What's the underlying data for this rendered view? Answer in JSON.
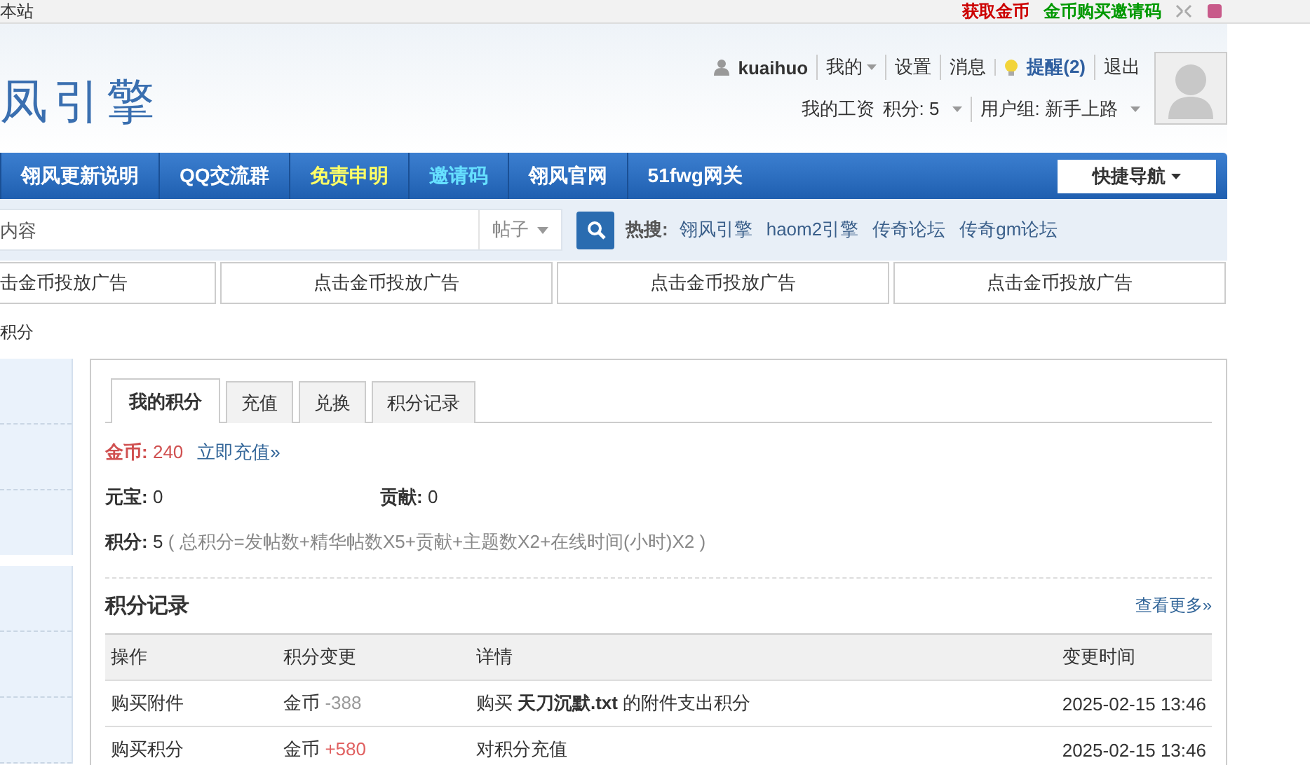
{
  "topbar": {
    "left": "本站",
    "links": [
      {
        "label": "获取金币",
        "color": "#cc0000"
      },
      {
        "label": "金币购买邀请码",
        "color": "#009900"
      }
    ]
  },
  "logo": "凤引擎",
  "user": {
    "name": "kuaihuo",
    "menu": [
      {
        "label": "我的",
        "dropdown": true
      },
      {
        "label": "设置",
        "dropdown": false
      },
      {
        "label": "消息",
        "dropdown": false
      }
    ],
    "notice": "提醒(2)",
    "logout": "退出",
    "salary": "我的工资",
    "credits": "积分: 5",
    "group": "用户组: 新手上路"
  },
  "nav": {
    "items": [
      {
        "label": "翎风更新说明",
        "kind": "plain"
      },
      {
        "label": "QQ交流群",
        "kind": "plain"
      },
      {
        "label": "免责申明",
        "kind": "notice"
      },
      {
        "label": "邀请码",
        "kind": "invite"
      },
      {
        "label": "翎风官网",
        "kind": "plain"
      },
      {
        "label": "51fwg网关",
        "kind": "plain"
      }
    ],
    "quick": "快捷导航"
  },
  "search": {
    "placeholder": "内容",
    "type": "帖子",
    "hot_label": "热搜:",
    "hot": [
      "翎风引擎",
      "haom2引擎",
      "传奇论坛",
      "传奇gm论坛"
    ]
  },
  "ads": [
    "击金币投放广告",
    "点击金币投放广告",
    "点击金币投放广告",
    "点击金币投放广告"
  ],
  "breadcrumb": "积分",
  "tabs": [
    {
      "label": "我的积分",
      "selected": true
    },
    {
      "label": "充值",
      "selected": false
    },
    {
      "label": "兑换",
      "selected": false
    },
    {
      "label": "积分记录",
      "selected": false
    }
  ],
  "gold": {
    "label": "金币:",
    "value": "240",
    "link": "立即充值»"
  },
  "stats": [
    {
      "label": "元宝:",
      "value": "0"
    },
    {
      "label": "贡献:",
      "value": "0"
    }
  ],
  "score": {
    "label": "积分:",
    "value": "5",
    "formula": "( 总积分=发帖数+精华帖数X5+贡献+主题数X2+在线时间(小时)X2 )"
  },
  "log": {
    "title": "积分记录",
    "more": "查看更多»",
    "columns": [
      "操作",
      "积分变更",
      "详情",
      "变更时间"
    ],
    "rows": [
      {
        "action": "购买附件",
        "currency": "金币",
        "amount": "-388",
        "kind": "debit",
        "detail": "购买 **天刀沉默.txt** 的附件支出积分",
        "time": "2025-02-15 13:46"
      },
      {
        "action": "购买积分",
        "currency": "金币",
        "amount": "+580",
        "kind": "credit",
        "detail": "对积分充值",
        "time": "2025-02-15 13:46"
      }
    ]
  }
}
